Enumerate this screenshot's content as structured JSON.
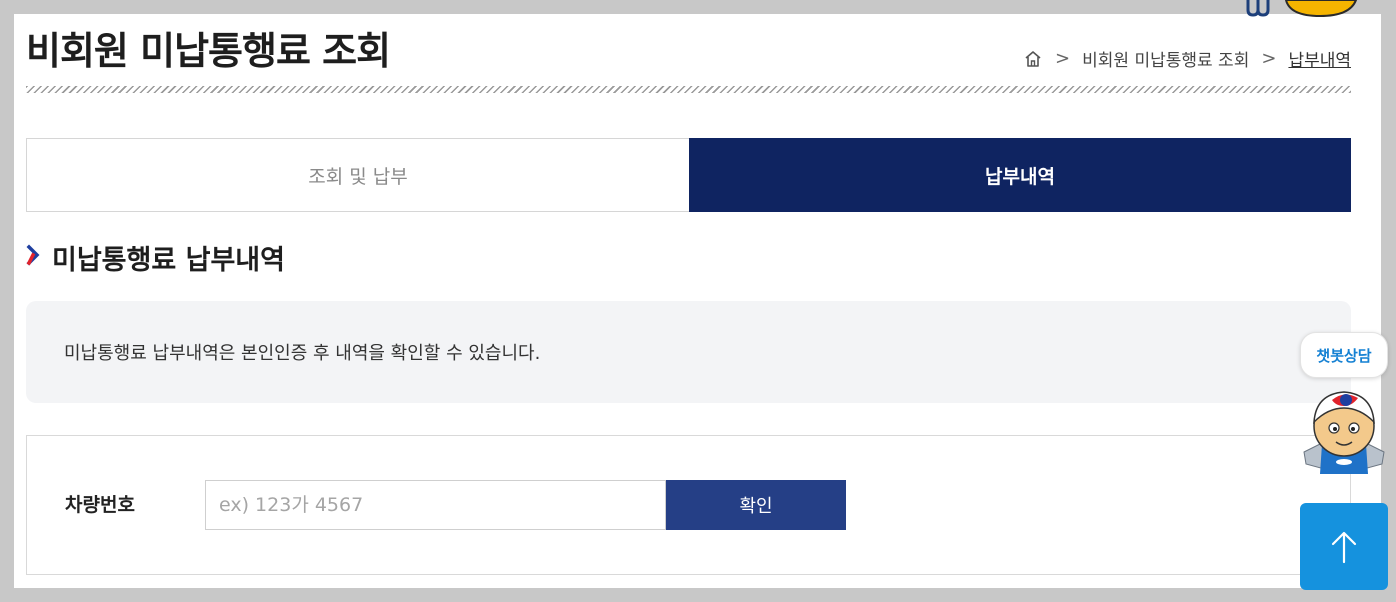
{
  "header": {
    "title": "비회원 미납통행료 조회",
    "breadcrumb": [
      "비회원 미납통행료 조회",
      "납부내역"
    ]
  },
  "tabs": [
    {
      "label": "조회 및 납부",
      "active": false
    },
    {
      "label": "납부내역",
      "active": true
    }
  ],
  "section": {
    "title": "미납통행료 납부내역",
    "notice": "미납통행료 납부내역은 본인인증 후 내역을 확인할 수 있습니다."
  },
  "form": {
    "label": "차량번호",
    "placeholder": "ex) 123가 4567",
    "value": "",
    "confirm_label": "확인"
  },
  "chatbot": {
    "label": "챗봇상담"
  },
  "colors": {
    "active_tab": "#0f2461",
    "confirm_button": "#253f86",
    "scroll_top": "#1592de",
    "chatbot_text": "#1581d3"
  },
  "icons": [
    "home-icon",
    "chevron-right-icon",
    "arrow-up-icon"
  ]
}
